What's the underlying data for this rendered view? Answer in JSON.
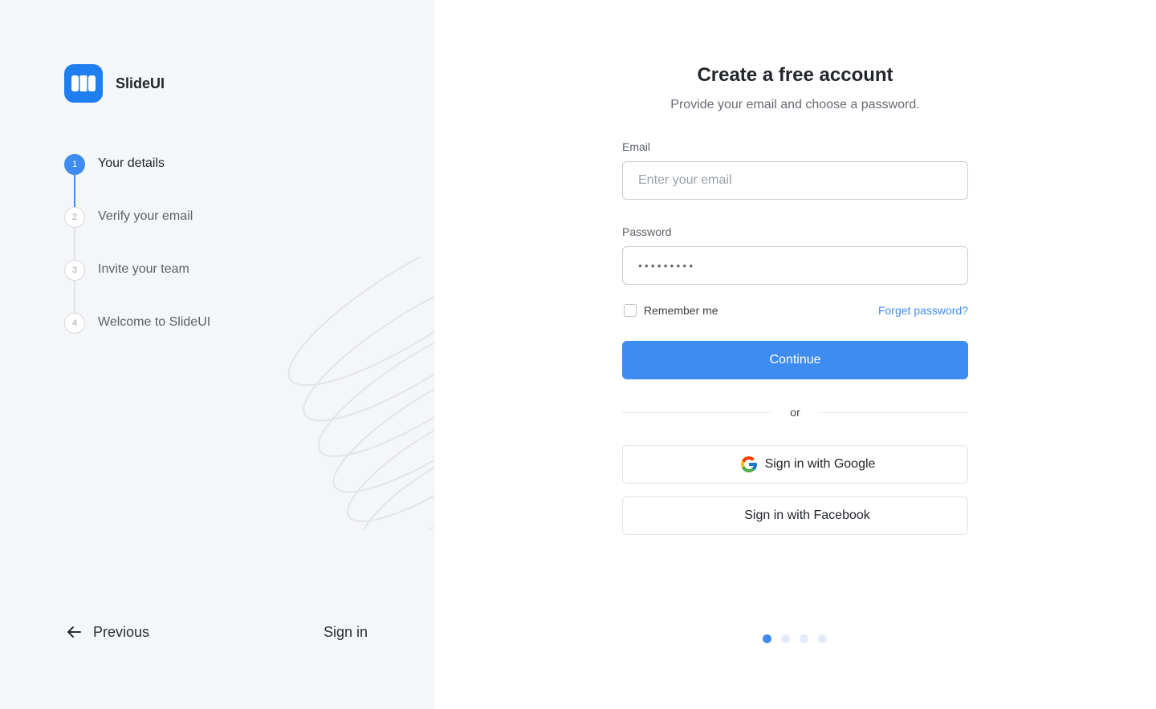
{
  "brand": {
    "name": "SlideUI",
    "logo_icon": "slideui-logo-icon",
    "accent": "#3f8cf0"
  },
  "steps": [
    {
      "number": "1",
      "label": "Your details",
      "active": true
    },
    {
      "number": "2",
      "label": "Verify your email",
      "active": false
    },
    {
      "number": "3",
      "label": "Invite your team",
      "active": false
    },
    {
      "number": "4",
      "label": "Welcome to SlideUI",
      "active": false
    }
  ],
  "nav": {
    "previous_label": "Previous",
    "previous_icon": "arrow-left-icon",
    "signin_label": "Sign in"
  },
  "form": {
    "title": "Create a free account",
    "subtitle": "Provide your email and choose a password.",
    "email_label": "Email",
    "email_placeholder": "Enter your email",
    "email_value": "",
    "password_label": "Password",
    "password_value": "•••••••••",
    "remember_label": "Remember me",
    "remember_checked": false,
    "forgot_label": "Forget password?",
    "continue_label": "Continue",
    "or_label": "or",
    "google_label": "Sign in with Google",
    "google_icon": "google-icon",
    "facebook_label": "Sign in with Facebook"
  },
  "pagination": {
    "total": 4,
    "current": 1
  }
}
